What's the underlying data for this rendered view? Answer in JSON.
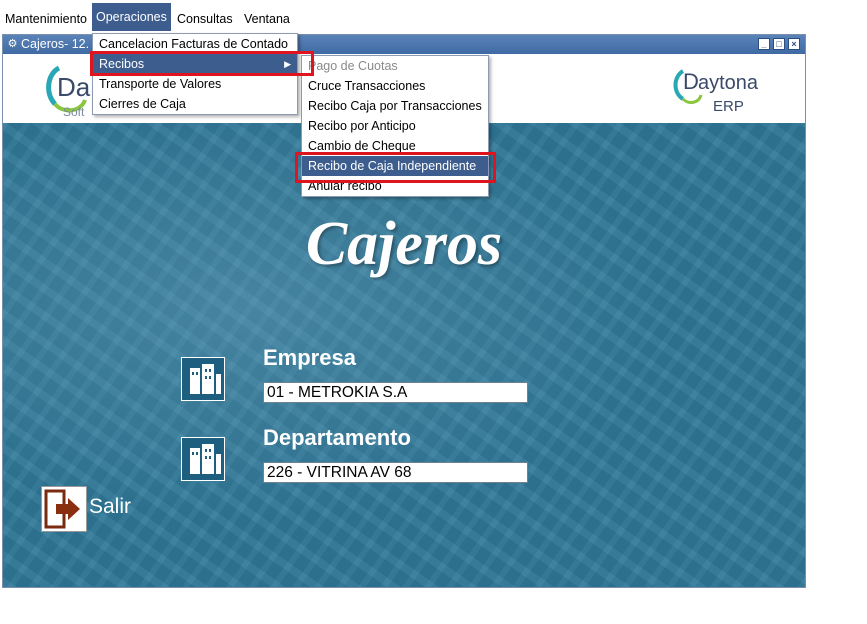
{
  "menubar": {
    "items": [
      {
        "label": "Mantenimiento"
      },
      {
        "label": "Operaciones"
      },
      {
        "label": "Consultas"
      },
      {
        "label": "Ventana"
      }
    ]
  },
  "window": {
    "title": "Cajeros- 12."
  },
  "hero": {
    "title": "Cajeros"
  },
  "logos": {
    "left_text": "Soft",
    "right_name": "aytona",
    "right_sub": "ERP"
  },
  "form": {
    "empresa_label": "Empresa",
    "empresa_value": "01 - METROKIA S.A",
    "departamento_label": "Departamento",
    "departamento_value": "226 - VITRINA AV 68"
  },
  "salir_label": "Salir",
  "operaciones_menu": {
    "items": [
      {
        "label": "Cancelacion Facturas de Contado"
      },
      {
        "label": "Recibos"
      },
      {
        "label": "Transporte de Valores"
      },
      {
        "label": "Cierres de Caja"
      }
    ]
  },
  "recibos_menu": {
    "items": [
      {
        "label": "Pago de Cuotas"
      },
      {
        "label": "Cruce Transacciones"
      },
      {
        "label": "Recibo Caja por Transacciones"
      },
      {
        "label": "Recibo por Anticipo"
      },
      {
        "label": "Cambio de Cheque"
      },
      {
        "label": "Recibo de Caja Independiente"
      },
      {
        "label": "Anular recibo"
      }
    ]
  },
  "colors": {
    "accent": "#3c5d8e",
    "highlight": "#e0141e",
    "background": "#2f7898"
  }
}
